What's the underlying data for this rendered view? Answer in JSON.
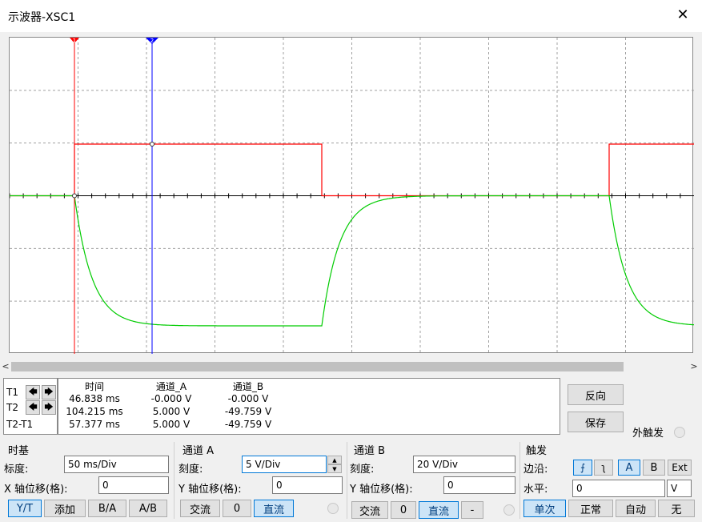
{
  "window": {
    "title": "示波器-XSC1",
    "close_glyph": "✕"
  },
  "screen": {
    "background": "#ffffff",
    "grid_color": "#a0a0a0",
    "channel_a_color": "#ff0000",
    "channel_b_color": "#00cc00",
    "cursor1_color": "#ff0000",
    "cursor2_color": "#0000ff",
    "cursor1_label": "1",
    "cursor2_label": "2"
  },
  "cursors": {
    "rows": [
      "T1",
      "T2",
      "T2-T1"
    ],
    "left_arrow": "🡄",
    "right_arrow": "🡆"
  },
  "readout": {
    "headers": [
      "时间",
      "通道_A",
      "通道_B"
    ],
    "rows": [
      [
        "46.838 ms",
        "-0.000 V",
        "-0.000 V"
      ],
      [
        "104.215 ms",
        "5.000 V",
        "-49.759 V"
      ],
      [
        "57.377 ms",
        "5.000 V",
        "-49.759 V"
      ]
    ]
  },
  "side_buttons": {
    "reverse": "反向",
    "save": "保存",
    "ext_trigger": "外触发"
  },
  "timebase": {
    "group": "时基",
    "scale_label": "标度:",
    "scale_value": "50 ms/Div",
    "xpos_label": "X 轴位移(格):",
    "xpos_value": "0",
    "modes": [
      "Y/T",
      "添加",
      "B/A",
      "A/B"
    ]
  },
  "channel_a": {
    "group": "通道 A",
    "scale_label": "刻度:",
    "scale_value": "5  V/Div",
    "ypos_label": "Y 轴位移(格):",
    "ypos_value": "0",
    "coupling": [
      "交流",
      "0",
      "直流"
    ]
  },
  "channel_b": {
    "group": "通道 B",
    "scale_label": "刻度:",
    "scale_value": "20  V/Div",
    "ypos_label": "Y 轴位移(格):",
    "ypos_value": "0",
    "coupling": [
      "交流",
      "0",
      "直流",
      "-"
    ]
  },
  "trigger": {
    "group": "触发",
    "edge_label": "边沿:",
    "edge_rise": "⨍",
    "edge_fall": "ʅ",
    "sources": [
      "A",
      "B",
      "Ext"
    ],
    "level_label": "水平:",
    "level_value": "0",
    "level_unit": "V",
    "modes": [
      "单次",
      "正常",
      "自动",
      "无"
    ]
  }
}
